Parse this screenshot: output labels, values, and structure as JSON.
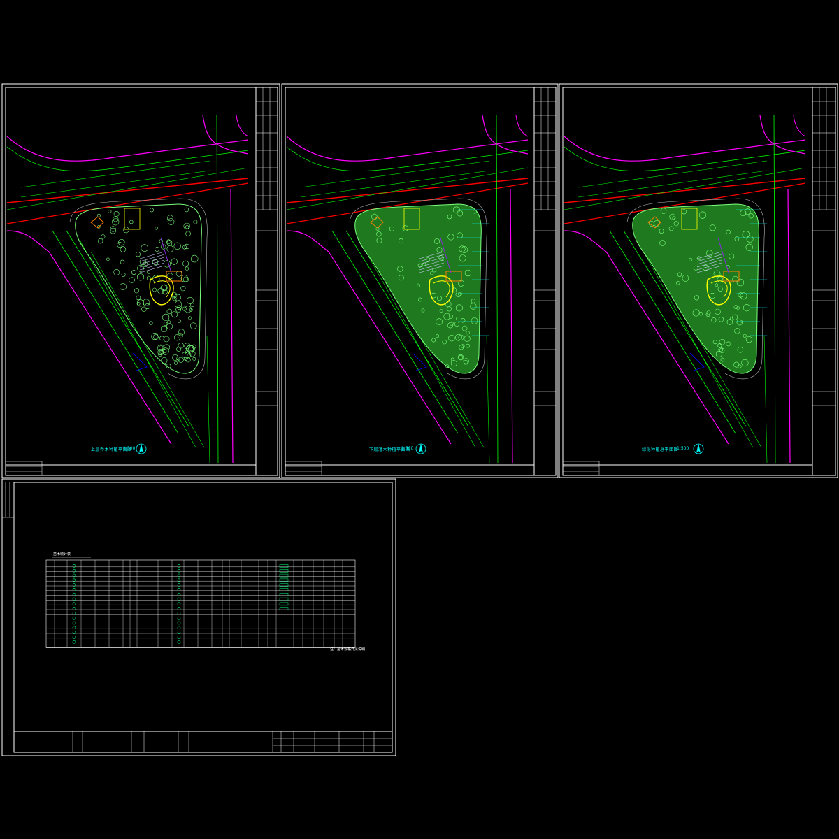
{
  "drawing": {
    "sheets": [
      {
        "id": "sheet-1",
        "plan_label": "上层乔木种植平面图",
        "scale": "1:500"
      },
      {
        "id": "sheet-2",
        "plan_label": "下层灌木种植平面图",
        "scale": "1:500"
      },
      {
        "id": "sheet-3",
        "plan_label": "绿化种植总平面图",
        "scale": "1:500"
      }
    ],
    "table_sheet": {
      "table_title": "苗木统计表",
      "note": "注：苗木规格详见说明",
      "colors": {
        "header": "#ffffff",
        "grid": "#ffffff",
        "swatch": "#00ff7f"
      }
    }
  },
  "colors": {
    "background": "#000000",
    "frame": "#ffffff",
    "road_magenta": "#ff00ff",
    "road_red": "#ff0000",
    "road_green": "#00ff00",
    "planting_fill": "#1f7a1f",
    "tree": "#7cff7c",
    "label_cyan": "#00ffff",
    "accent_orange": "#ff7f00",
    "accent_yellow": "#ffff00",
    "blue": "#0000ff"
  }
}
